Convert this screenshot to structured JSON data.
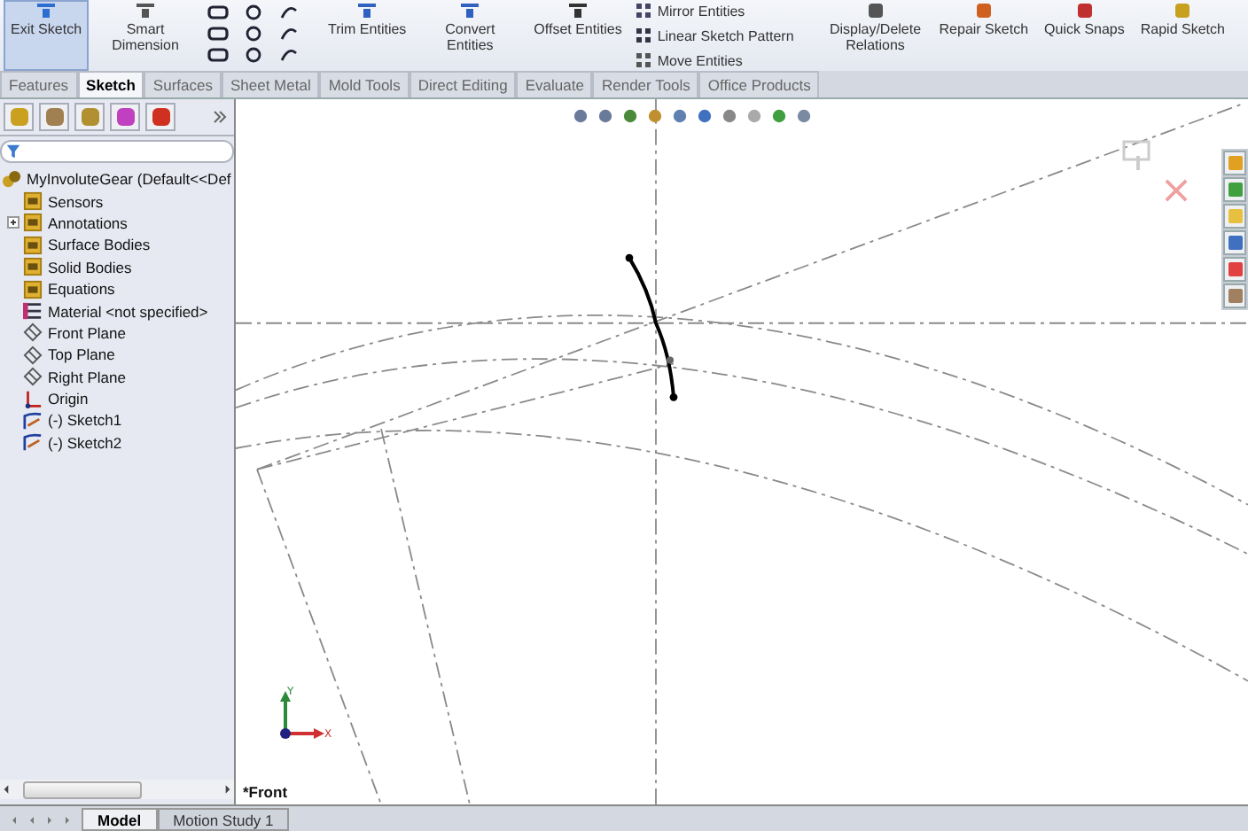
{
  "toolbar": {
    "buttons": [
      {
        "label": "Exit Sketch",
        "kind": "exit",
        "active": true
      },
      {
        "label": "Smart Dimension",
        "kind": "dimension",
        "active": false
      },
      {
        "label": "Trim Entities",
        "kind": "trim",
        "active": false
      },
      {
        "label": "Convert Entities",
        "kind": "convert",
        "active": false
      },
      {
        "label": "Offset Entities",
        "kind": "offset",
        "active": false
      }
    ],
    "stack": [
      {
        "label": "Mirror Entities",
        "kind": "mirror"
      },
      {
        "label": "Linear Sketch Pattern",
        "kind": "pattern"
      },
      {
        "label": "Move Entities",
        "kind": "move"
      }
    ],
    "buttons_right": [
      {
        "label": "Display/Delete Relations",
        "kind": "relations",
        "active": false
      },
      {
        "label": "Repair Sketch",
        "kind": "repair",
        "active": false
      },
      {
        "label": "Quick Snaps",
        "kind": "snaps",
        "active": false
      },
      {
        "label": "Rapid Sketch",
        "kind": "rapid",
        "active": false
      }
    ]
  },
  "command_tabs": [
    {
      "label": "Features",
      "selected": false
    },
    {
      "label": "Sketch",
      "selected": true
    },
    {
      "label": "Surfaces",
      "selected": false
    },
    {
      "label": "Sheet Metal",
      "selected": false
    },
    {
      "label": "Mold Tools",
      "selected": false
    },
    {
      "label": "Direct Editing",
      "selected": false
    },
    {
      "label": "Evaluate",
      "selected": false
    },
    {
      "label": "Render Tools",
      "selected": false
    },
    {
      "label": "Office Products",
      "selected": false
    }
  ],
  "feature_tree": {
    "root": {
      "label": "MyInvoluteGear  (Default<<Def",
      "children": [
        {
          "label": "Sensors",
          "kind": "sensor",
          "collapsed": false
        },
        {
          "label": "Annotations",
          "kind": "annotation",
          "collapsed": true
        },
        {
          "label": "Surface Bodies",
          "kind": "folder",
          "collapsed": false
        },
        {
          "label": "Solid Bodies",
          "kind": "folder",
          "collapsed": false
        },
        {
          "label": "Equations",
          "kind": "equation",
          "collapsed": false
        },
        {
          "label": "Material <not specified>",
          "kind": "material",
          "collapsed": false
        },
        {
          "label": "Front Plane",
          "kind": "plane",
          "collapsed": false
        },
        {
          "label": "Top Plane",
          "kind": "plane",
          "collapsed": false
        },
        {
          "label": "Right Plane",
          "kind": "plane",
          "collapsed": false
        },
        {
          "label": "Origin",
          "kind": "origin",
          "collapsed": false
        },
        {
          "label": "(-) Sketch1",
          "kind": "sketch",
          "collapsed": false
        },
        {
          "label": "(-) Sketch2",
          "kind": "sketch",
          "collapsed": false
        }
      ]
    }
  },
  "viewport": {
    "view_label": "*Front",
    "triad": {
      "x_label": "X",
      "y_label": "Y"
    }
  },
  "bottom_tabs": [
    {
      "label": "Model",
      "selected": true
    },
    {
      "label": "Motion Study 1",
      "selected": false
    }
  ]
}
